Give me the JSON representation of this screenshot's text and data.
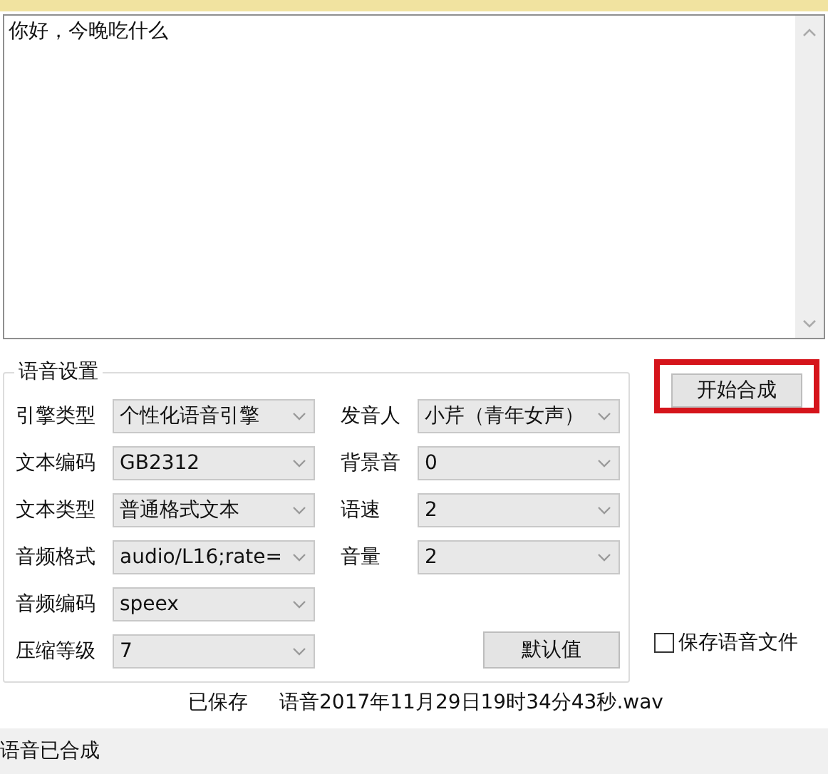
{
  "editor": {
    "value": "你好，今晚吃什么"
  },
  "settings": {
    "title": "语音设置",
    "left": [
      {
        "label": "引擎类型",
        "value": "个性化语音引擎"
      },
      {
        "label": "文本编码",
        "value": "GB2312"
      },
      {
        "label": "文本类型",
        "value": "普通格式文本"
      },
      {
        "label": "音频格式",
        "value": "audio/L16;rate="
      },
      {
        "label": "音频编码",
        "value": "speex"
      },
      {
        "label": "压缩等级",
        "value": "7"
      }
    ],
    "right": [
      {
        "label": "发音人",
        "value": "小芹（青年女声）"
      },
      {
        "label": "背景音",
        "value": "0"
      },
      {
        "label": "语速",
        "value": "2"
      },
      {
        "label": "音量",
        "value": "2"
      }
    ],
    "default_button": "默认值"
  },
  "synthesize_button": {
    "label": "开始合成",
    "highlighted": true
  },
  "save_file": {
    "label": "保存语音文件",
    "checked": false
  },
  "saved_message": [
    "已保存",
    "语音2017年11月29日19时34分43秒.wav"
  ],
  "status_bar": "语音已合成"
}
